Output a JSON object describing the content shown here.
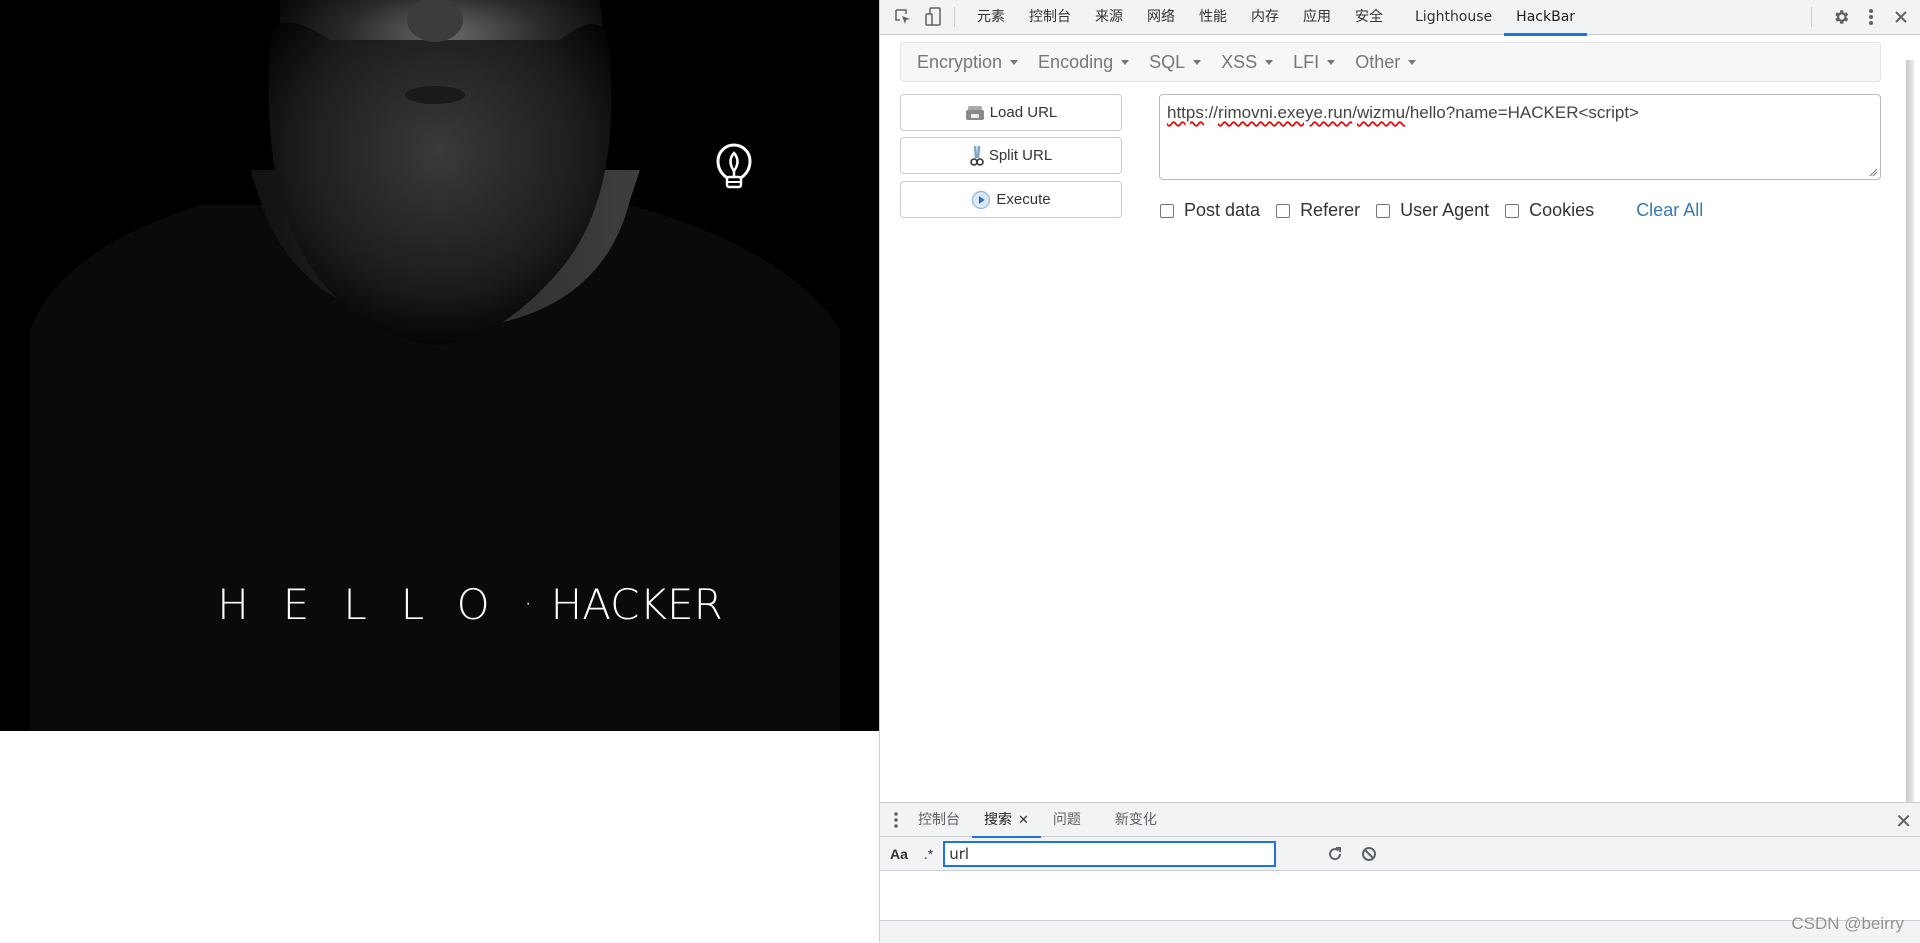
{
  "page": {
    "hero_text_spaced": "HELLO",
    "hero_dot": "·",
    "hero_name": "HACKER",
    "bulb_icon": "lightbulb-icon"
  },
  "devtools": {
    "toolbar": {
      "inspect_icon": "inspect-element-icon",
      "device_icon": "device-toolbar-icon",
      "tabs": [
        {
          "label": "元素",
          "active": false
        },
        {
          "label": "控制台",
          "active": false
        },
        {
          "label": "来源",
          "active": false
        },
        {
          "label": "网络",
          "active": false
        },
        {
          "label": "性能",
          "active": false
        },
        {
          "label": "内存",
          "active": false
        },
        {
          "label": "应用",
          "active": false
        },
        {
          "label": "安全",
          "active": false
        },
        {
          "label": "Lighthouse",
          "active": false
        },
        {
          "label": "HackBar",
          "active": true
        }
      ],
      "settings_icon": "gear-icon",
      "more_icon": "kebab-menu-icon",
      "close_icon": "close-icon"
    },
    "hackbar": {
      "menu": [
        {
          "label": "Encryption"
        },
        {
          "label": "Encoding"
        },
        {
          "label": "SQL"
        },
        {
          "label": "XSS"
        },
        {
          "label": "LFI"
        },
        {
          "label": "Other"
        }
      ],
      "buttons": {
        "load_url": "Load URL",
        "split_url": "Split URL",
        "execute": "Execute"
      },
      "url": {
        "scheme": "https",
        "sep1": "://",
        "host": "rimovni.exeye.run",
        "sep2": "/",
        "path1": "wizmu",
        "rest": "/hello?name=HACKER<script>"
      },
      "options": {
        "post_data": {
          "label": "Post data",
          "checked": false
        },
        "referer": {
          "label": "Referer",
          "checked": false
        },
        "user_agent": {
          "label": "User Agent",
          "checked": false
        },
        "cookies": {
          "label": "Cookies",
          "checked": false
        }
      },
      "clear_all": "Clear All"
    },
    "drawer": {
      "tabs": [
        {
          "label": "控制台",
          "active": false
        },
        {
          "label": "搜索",
          "active": true,
          "closable": true
        },
        {
          "label": "问题",
          "active": false
        },
        {
          "label": "新变化",
          "active": false
        }
      ],
      "close_label": "✕",
      "search": {
        "match_case_label": "Aa",
        "regex_label": ".*",
        "query": "url"
      }
    }
  },
  "watermark": "CSDN @beirry",
  "colors": {
    "accent_blue": "#1a73e8",
    "link_blue": "#337ab7",
    "devtools_bg": "#f1f3f4"
  }
}
